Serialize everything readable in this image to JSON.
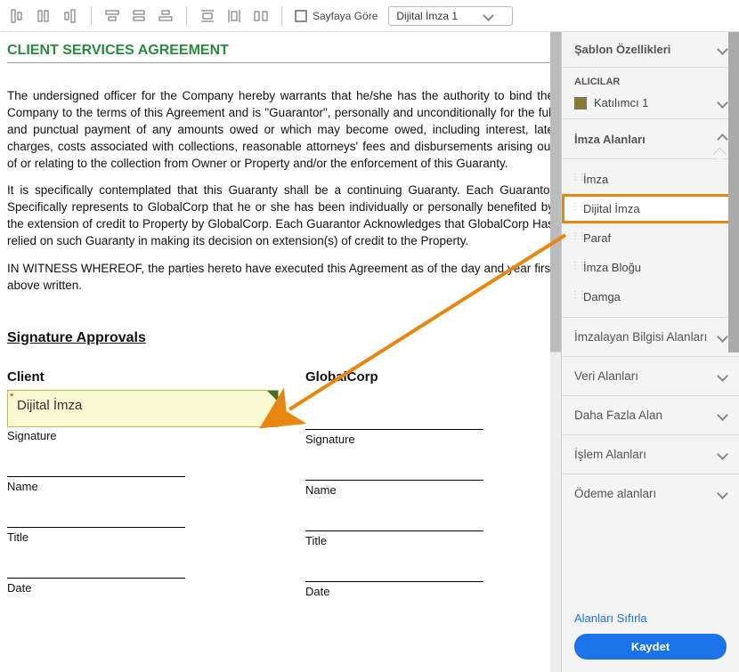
{
  "toolbar": {
    "page_mode_label": "Sayfaya Göre",
    "combo_value": "Dijital İmza 1"
  },
  "doc": {
    "title": "CLIENT SERVICES AGREEMENT",
    "p1": "The undersigned officer for the Company hereby warrants that he/she has the authority to bind the Company to the terms of this Agreement and is \"Guarantor\", personally and unconditionally for the full and punctual payment of any amounts owed or which may become owed, including interest, late charges, costs associated with collections, reasonable attorneys' fees and disbursements arising out of or relating to the collection from Owner or Property and/or the enforcement of this Guaranty.",
    "p2": "It is specifically contemplated that this Guaranty shall be a continuing Guaranty. Each Guarantor Specifically represents to GlobalCorp that he or she has been individually or personally benefited by the extension of credit to Property by GlobalCorp. Each Guarantor Acknowledges that GlobalCorp Has relied on such Guaranty in making its decision on extension(s) of credit to the Property.",
    "p3": "IN WITNESS WHEREOF, the parties hereto have executed this Agreement as of the day and year first above written.",
    "sig_heading": "Signature Approvals",
    "client_head": "Client",
    "global_head": "GlobalCorp",
    "sigfield_label": "Dijital İmza",
    "labels": {
      "signature": "Signature",
      "name": "Name",
      "title": "Title",
      "date": "Date"
    }
  },
  "panel": {
    "template_props": "Şablon Özellikleri",
    "recipients_label": "ALICILAR",
    "recipient1": "Katılımcı 1",
    "sig_fields": "İmza Alanları",
    "fields": {
      "imza": "İmza",
      "dijital": "Dijital İmza",
      "paraf": "Paraf",
      "blok": "İmza Bloğu",
      "damga": "Damga"
    },
    "signer_info": "İmzalayan Bilgisi Alanları",
    "data_fields": "Veri Alanları",
    "more_fields": "Daha Fazla Alan",
    "trans_fields": "İşlem Alanları",
    "pay_fields": "Ödeme alanları",
    "reset": "Alanları Sıfırla",
    "save": "Kaydet"
  }
}
